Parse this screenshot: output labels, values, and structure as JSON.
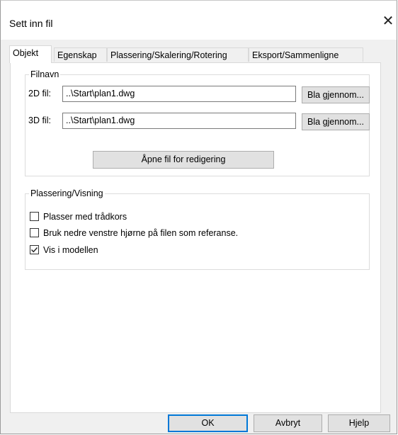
{
  "window": {
    "title": "Sett inn fil",
    "close_icon": "close-icon"
  },
  "tabs": [
    {
      "label": "Objekt",
      "active": true
    },
    {
      "label": "Egenskap",
      "active": false
    },
    {
      "label": "Plassering/Skalering/Rotering",
      "active": false
    },
    {
      "label": "Eksport/Sammenligne",
      "active": false
    }
  ],
  "filnavn": {
    "legend": "Filnavn",
    "file2d": {
      "label": "2D fil:",
      "value": "..\\Start\\plan1.dwg",
      "browse": "Bla gjennom..."
    },
    "file3d": {
      "label": "3D fil:",
      "value": "..\\Start\\plan1.dwg",
      "browse": "Bla gjennom..."
    },
    "open_button": "Åpne fil for redigering"
  },
  "plassering": {
    "legend": "Plassering/Visning",
    "options": [
      {
        "label": "Plasser med trådkors",
        "checked": false
      },
      {
        "label": "Bruk nedre venstre hjørne på filen som referanse.",
        "checked": false
      },
      {
        "label": "Vis i modellen",
        "checked": true
      }
    ]
  },
  "footer": {
    "ok": "OK",
    "cancel": "Avbryt",
    "help": "Hjelp"
  }
}
